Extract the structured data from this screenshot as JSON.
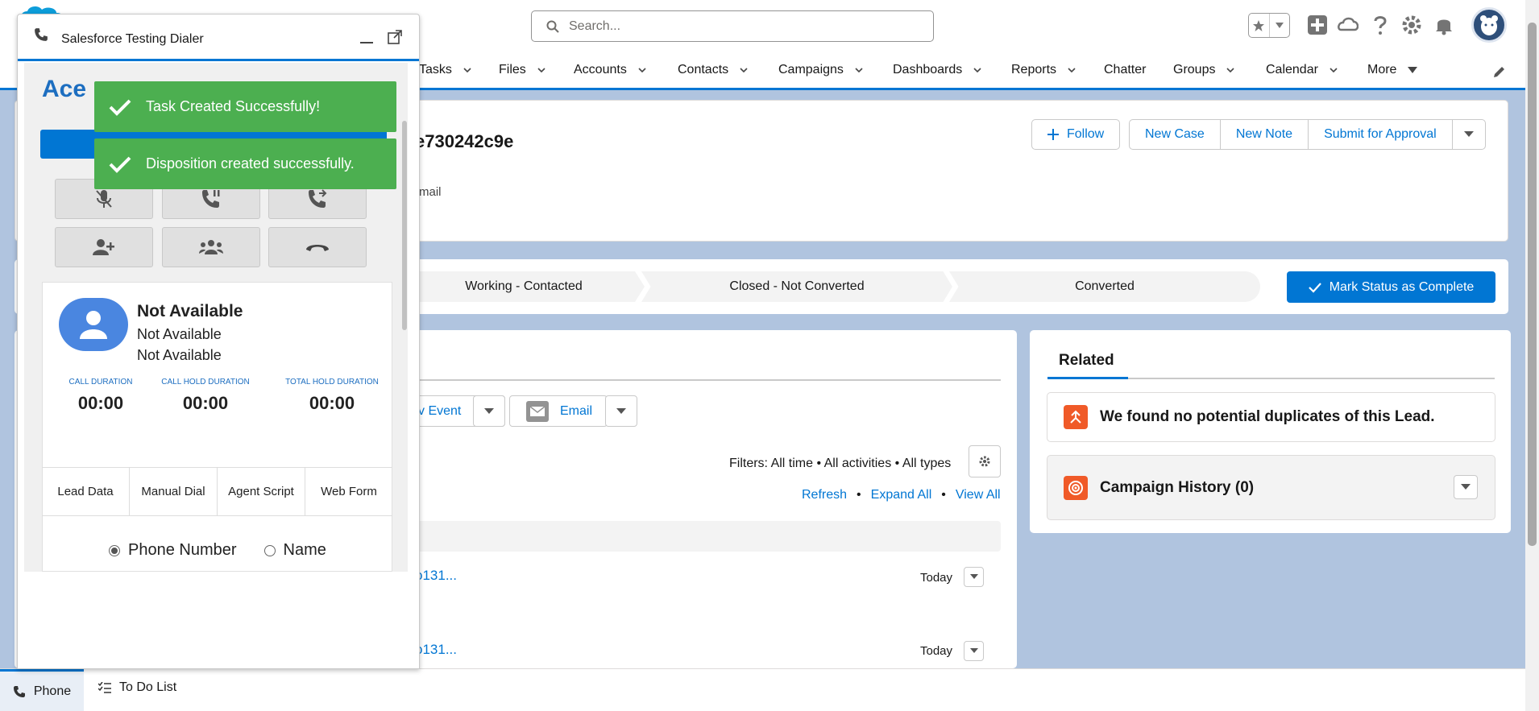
{
  "header": {
    "search_placeholder": "Search..."
  },
  "nav": {
    "items": [
      {
        "label": "Tasks",
        "has_menu": true
      },
      {
        "label": "Files",
        "has_menu": true
      },
      {
        "label": "Accounts",
        "has_menu": true
      },
      {
        "label": "Contacts",
        "has_menu": true
      },
      {
        "label": "Campaigns",
        "has_menu": true
      },
      {
        "label": "Dashboards",
        "has_menu": true
      },
      {
        "label": "Reports",
        "has_menu": true
      },
      {
        "label": "Chatter",
        "has_menu": false
      },
      {
        "label": "Groups",
        "has_menu": true
      },
      {
        "label": "Calendar",
        "has_menu": true
      },
      {
        "label": "More",
        "has_menu": true
      }
    ]
  },
  "record": {
    "title_fragment": "e730242c9e",
    "field_fragment": "mail",
    "actions": {
      "follow": "Follow",
      "new_case": "New Case",
      "new_note": "New Note",
      "submit": "Submit for Approval"
    }
  },
  "path": {
    "steps": [
      "Working - Contacted",
      "Closed - Not Converted",
      "Converted"
    ],
    "mark_complete": "Mark Status as Complete"
  },
  "activity": {
    "event_fragment": "v Event",
    "email_label": "Email",
    "filters": "Filters: All time • All activities • All types",
    "links": {
      "refresh": "Refresh",
      "expand": "Expand All",
      "view_all": "View All"
    },
    "rows": [
      {
        "link": "o131...",
        "date": "Today"
      },
      {
        "link": "o131...",
        "date": "Today"
      }
    ]
  },
  "related": {
    "tab": "Related",
    "duplicates": "We found no potential duplicates of this Lead.",
    "campaign_history": "Campaign History (0)"
  },
  "utility": {
    "phone": "Phone",
    "todo": "To Do List"
  },
  "dialer": {
    "title": "Salesforce Testing Dialer",
    "logo_text": "Ace",
    "agent": {
      "status": "Not Available",
      "line2": "Not Available",
      "line3": "Not Available"
    },
    "durations": [
      {
        "label": "CALL DURATION",
        "value": "00:00"
      },
      {
        "label": "CALL HOLD DURATION",
        "value": "00:00"
      },
      {
        "label": "TOTAL HOLD DURATION",
        "value": "00:00"
      }
    ],
    "tabs": [
      "Lead Data",
      "Manual Dial",
      "Agent Script",
      "Web Form"
    ],
    "radio": {
      "phone": "Phone Number",
      "name": "Name",
      "selected": "phone"
    }
  },
  "toasts": [
    "Task Created Successfully!",
    "Disposition created successfully."
  ],
  "colors": {
    "brand": "#0176d3",
    "toast": "#4caf50",
    "bg": "#b0c4df"
  }
}
